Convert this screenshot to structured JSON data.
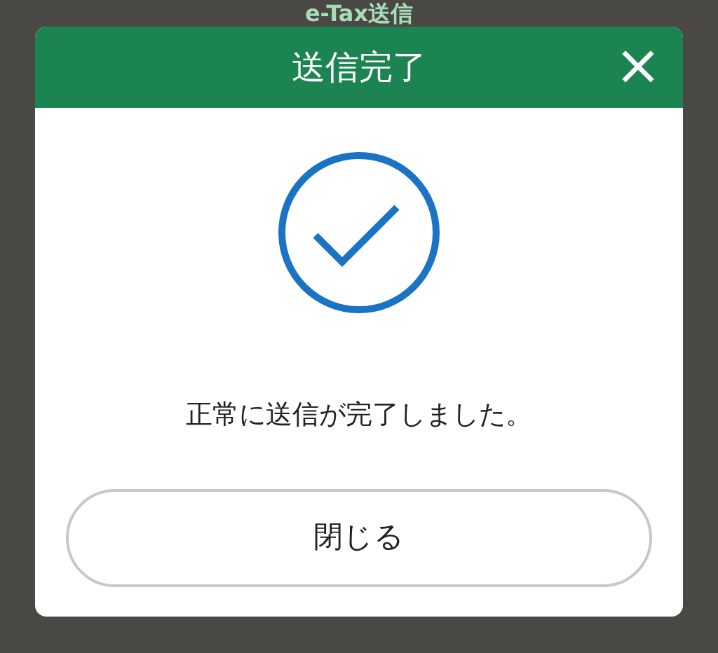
{
  "page": {
    "title": "e-Tax送信"
  },
  "dialog": {
    "title": "送信完了",
    "close": "×",
    "message": "正常に送信が完了しました。",
    "button": "閉じる"
  }
}
